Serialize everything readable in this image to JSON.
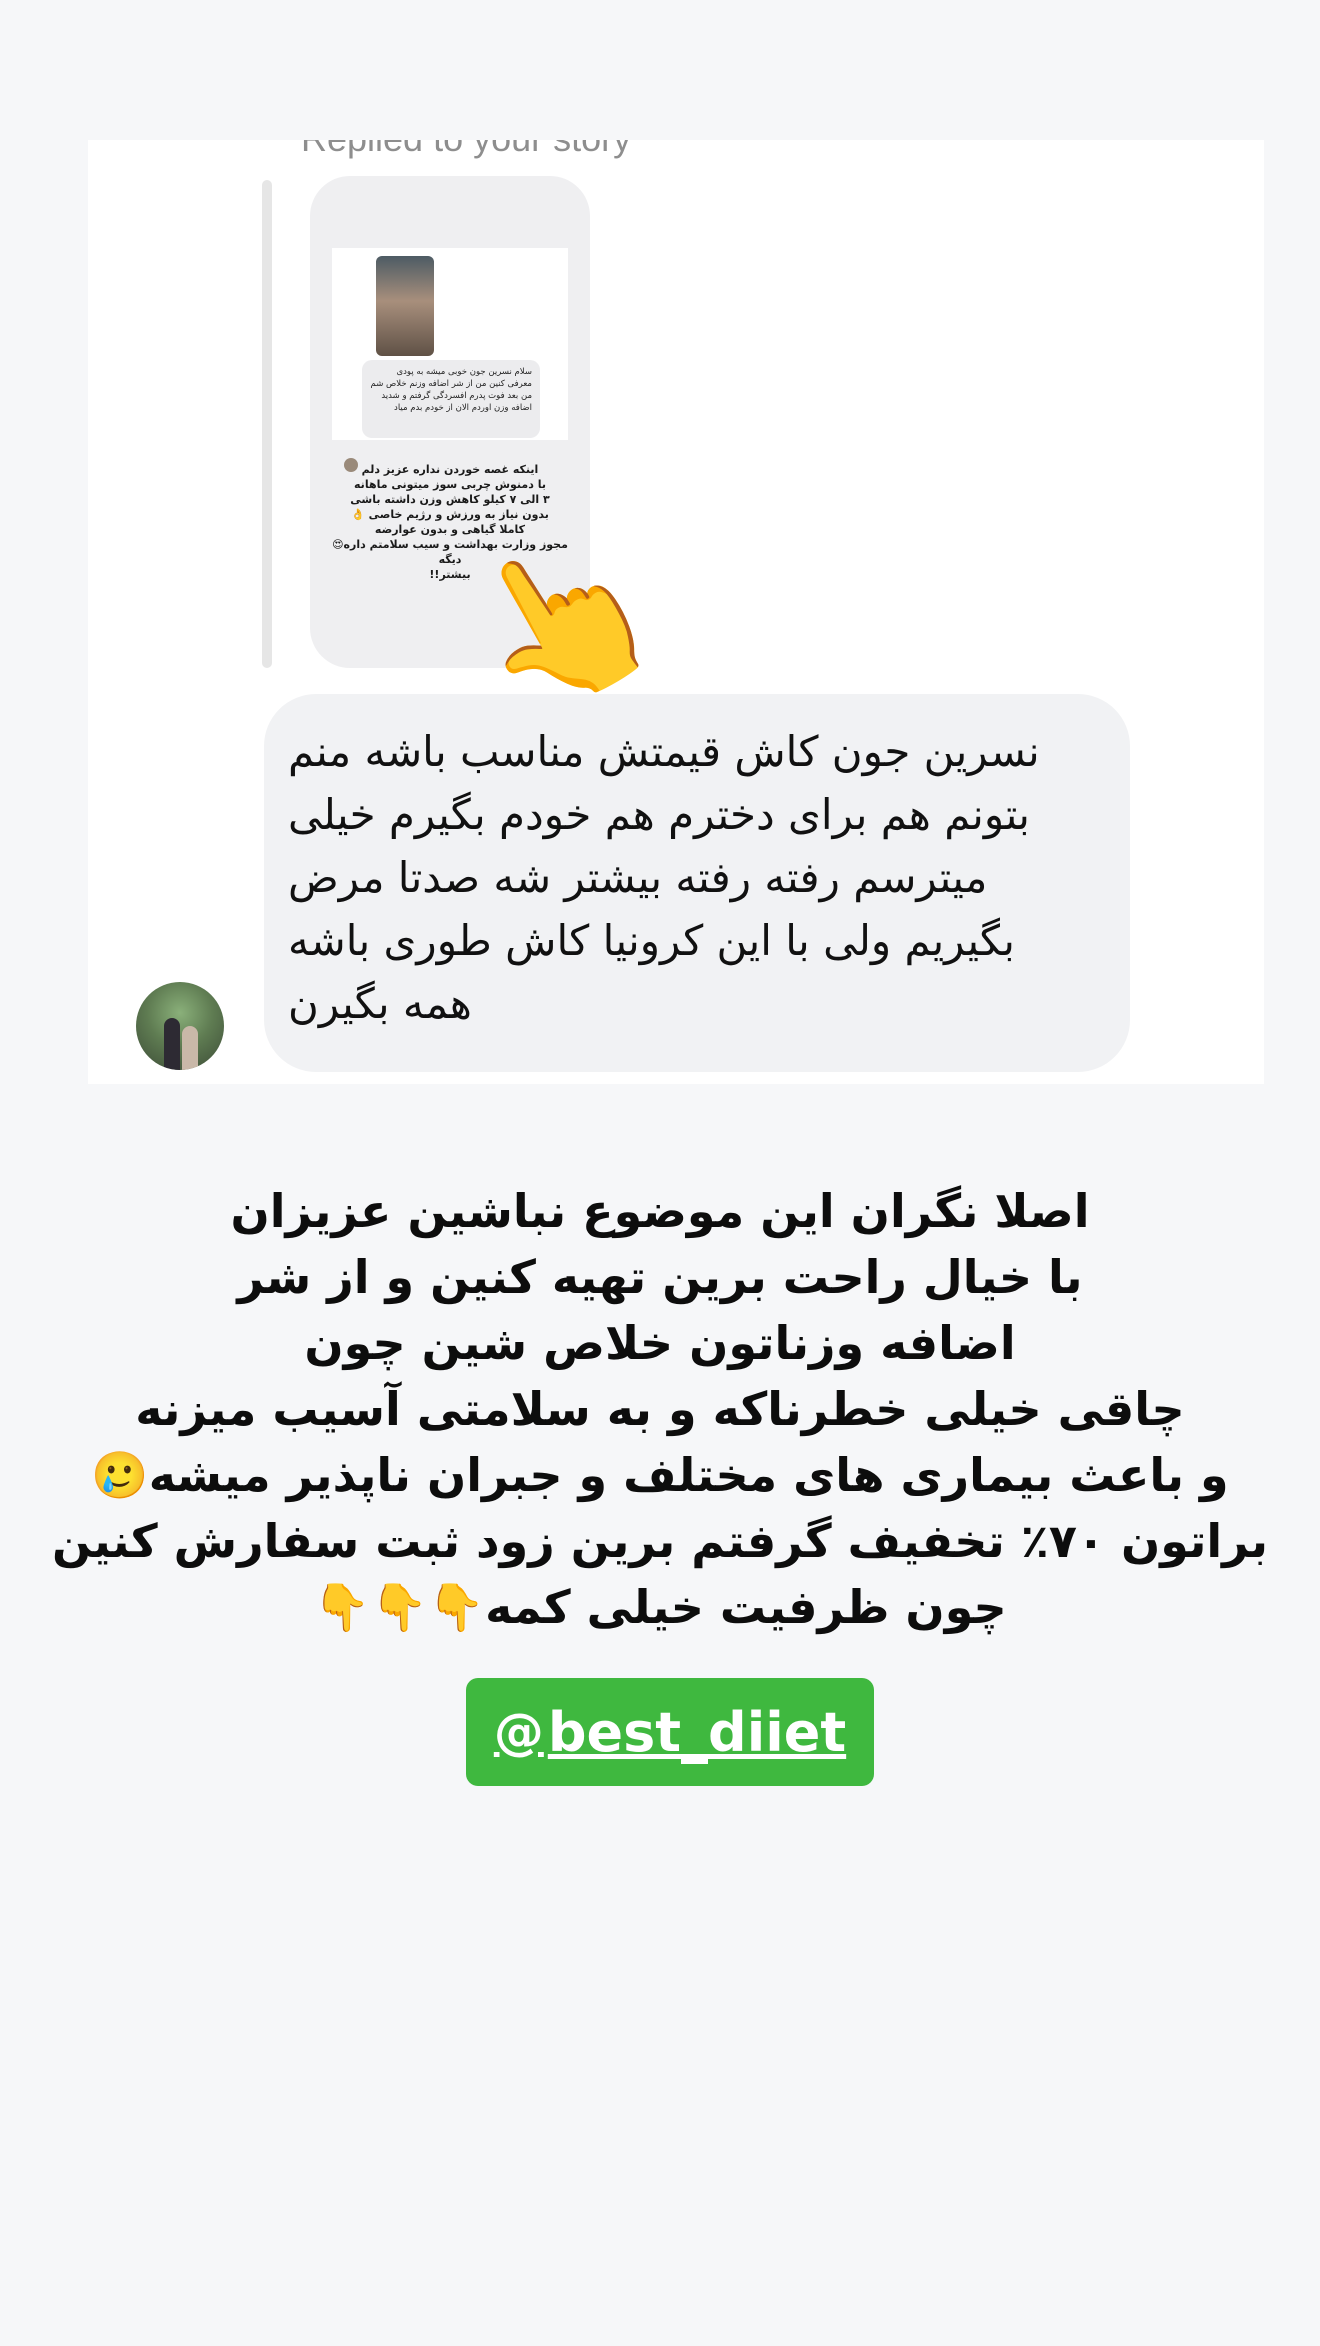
{
  "reply_card": {
    "replied_label": "Replied to your story",
    "story": {
      "bubble_text": "سلام نسرین جون خوبی میشه به پودی معرفی کنین من از شر اضافه وزنم خلاص شم من بعد فوت پدرم افسردگی گرفتم و شدید اضافه وزن اوردم الان از خودم بدم میاد",
      "caption_lines": [
        "اینکه غصه خوردن نداره عزیز دلم",
        "با دمنوش چربی سوز میتونی ماهانه",
        "۳ الی ۷ کیلو کاهش وزن داشته باشی",
        "بدون نیاز به ورزش و رژیم خاصی 👌",
        "کاملا گیاهی و بدون عوارضه",
        "مجوز وزارت بهداشت و سیب سلامتم داره😍",
        "دیگه",
        "بیشتر!!"
      ]
    },
    "hand_emoji": "👆",
    "reply_text": "نسرین جون کاش قیمتش مناسب باشه منم بتونم هم برای دخترم هم خودم بگیرم خیلی میترسم رفته رفته بیشتر شه صدتا مرض بگیریم ولی با این کرونیا کاش طوری باشه همه بگیرن"
  },
  "main_message": {
    "lines": [
      "اصلا نگران این موضوع نباشین عزیزان",
      "با خیال راحت برین تهیه کنین و از شر",
      "اضافه وزناتون خلاص شین چون",
      "چاقی خیلی خطرناکه و به سلامتی آسیب میزنه",
      "و باعث بیماری های مختلف و جبران ناپذیر میشه🥲",
      "براتون ۷۰٪ تخفیف گرفتم برین زود ثبت سفارش کنین",
      "چون ظرفیت خیلی کمه👇👇👇"
    ]
  },
  "handle": {
    "icon": "threads-icon",
    "text": "best_diiet",
    "color": "#3fb83f"
  }
}
